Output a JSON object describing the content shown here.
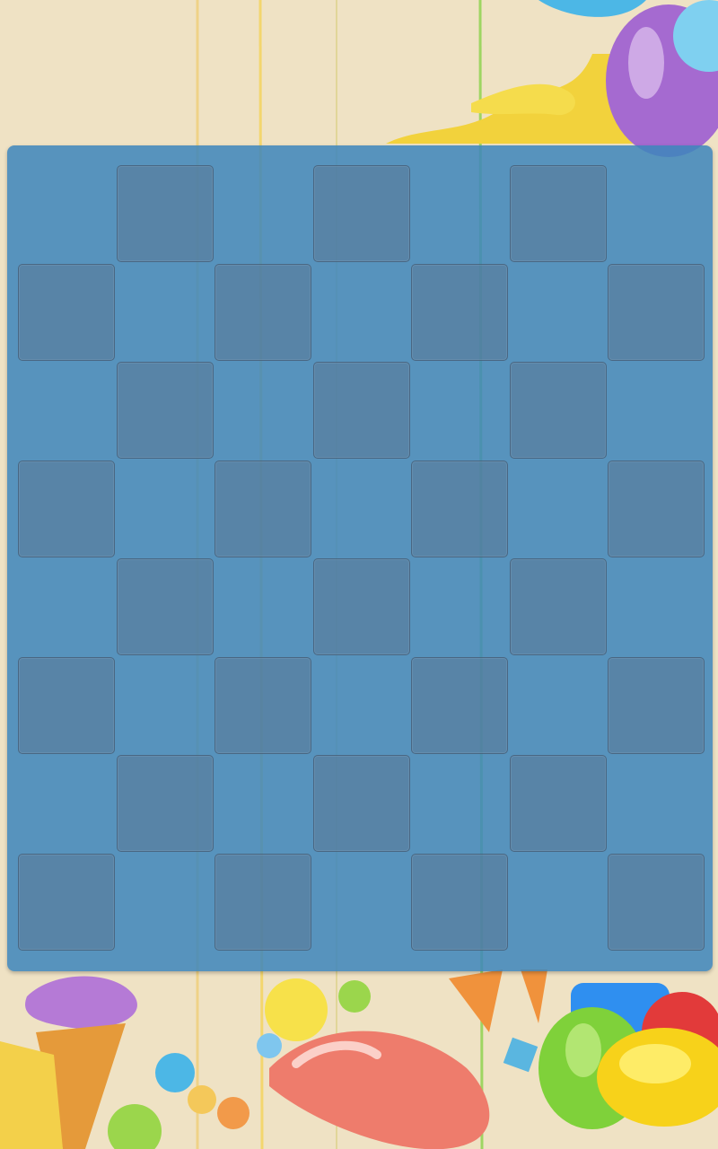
{
  "game": {
    "board": {
      "rows": 8,
      "cols": 7,
      "pattern": "checkerboard",
      "tile_color": "#5d86a8",
      "board_color": "#3e86bc"
    }
  }
}
